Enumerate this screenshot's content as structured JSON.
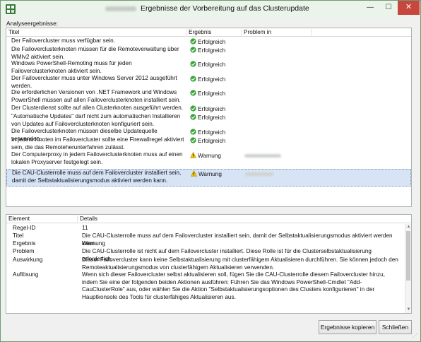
{
  "window": {
    "title": "Ergebnisse der Vorbereitung auf das Clusterupdate",
    "controls": {
      "minimize": "—",
      "maximize": "☐",
      "close": "✕"
    }
  },
  "section_label": "Analyseergebnisse:",
  "grid": {
    "columns": [
      "Titel",
      "Ergebnis",
      "Problem in"
    ],
    "rows": [
      {
        "title": "Der Failovercluster muss verfügbar sein.",
        "status": "Erfolgreich",
        "status_icon": "success-check-icon"
      },
      {
        "title": "Die Failoverclusterknoten müssen für die Remoteverwaltung über WMIv2 aktiviert sein.",
        "status": "Erfolgreich",
        "status_icon": "success-check-icon"
      },
      {
        "title": "Windows PowerShell-Remoting muss für jeden Failoverclusterknoten aktiviert sein.",
        "status": "Erfolgreich",
        "status_icon": "success-check-icon"
      },
      {
        "title": "Der Failovercluster muss unter Windows Server 2012 ausgeführt werden.",
        "status": "Erfolgreich",
        "status_icon": "success-check-icon"
      },
      {
        "title": "Die erforderlichen Versionen von .NET Framework und Windows PowerShell müssen auf allen Failoverclusterknoten installiert sein.",
        "status": "Erfolgreich",
        "status_icon": "success-check-icon"
      },
      {
        "title": "Der Clusterdienst sollte auf allen Clusterknoten ausgeführt werden.",
        "status": "Erfolgreich",
        "status_icon": "success-check-icon"
      },
      {
        "title": "\"Automatische Updates\" darf nicht zum automatischen Installieren von Updates auf Failoverclusterknoten konfiguriert sein.",
        "status": "Erfolgreich",
        "status_icon": "success-check-icon"
      },
      {
        "title": "Die Failoverclusterknoten müssen dieselbe Updatequelle verwenden.",
        "status": "Erfolgreich",
        "status_icon": "success-check-icon"
      },
      {
        "title": "In jedem Knoten im Failovercluster sollte eine Firewallregel aktiviert sein, die das Remoteherunterfahren zulässt.",
        "status": "Erfolgreich",
        "status_icon": "success-check-icon"
      },
      {
        "title": "Der Computerproxy in jedem Failoverclusterknoten muss auf einen lokalen Proxyserver festgelegt sein.",
        "status": "Warnung",
        "status_icon": "warning-triangle-icon"
      },
      {
        "title": "Die CAU-Clusterrolle muss auf dem Failovercluster installiert sein, damit der Selbstaktualisierungsmodus aktiviert werden kann.",
        "status": "Warnung",
        "status_icon": "warning-triangle-icon"
      }
    ]
  },
  "details": {
    "columns": [
      "Element",
      "Details"
    ],
    "rows": [
      {
        "key": "Regel-ID",
        "value": "11"
      },
      {
        "key": "Titel",
        "value": "Die CAU-Clusterrolle muss auf dem Failovercluster installiert sein, damit der Selbstaktualisierungsmodus aktiviert werden kann."
      },
      {
        "key": "Ergebnis",
        "value": "Warnung"
      },
      {
        "key": "Problem",
        "value": "Die CAU-Clusterrolle ist nicht auf dem Failovercluster installiert. Diese Rolle ist für die Clusterselbstaktualisierung erforderlich."
      },
      {
        "key": "Auswirkung",
        "value": "Dieser Failovercluster kann keine Selbstaktualisierung mit clusterfähigem Aktualisieren durchführen. Sie können jedoch den Remoteaktualisierungsmodus von clusterfähigem Aktualisieren verwenden."
      },
      {
        "key": "Auflösung",
        "value": "Wenn sich dieser Failovercluster selbst aktualisieren soll, fügen Sie die CAU-Clusterrolle diesem Failovercluster hinzu, indem Sie eine der folgenden beiden Aktionen ausführen: Führen Sie das Windows PowerShell-Cmdlet \"Add-CauClusterRole\" aus, oder wählen Sie die Aktion \"Selbstaktualisierungsoptionen des Clusters konfigurieren\" in der Hauptkonsole des Tools für clusterfähiges Aktualisieren aus."
      }
    ]
  },
  "buttons": {
    "copy": "Ergebnisse kopieren",
    "close": "Schließen"
  },
  "colors": {
    "success": "#3aa33a",
    "warning": "#f2c300",
    "selection": "#d6e4f5",
    "title_bar": "#eaf4ea",
    "close_button": "#c7463d"
  }
}
